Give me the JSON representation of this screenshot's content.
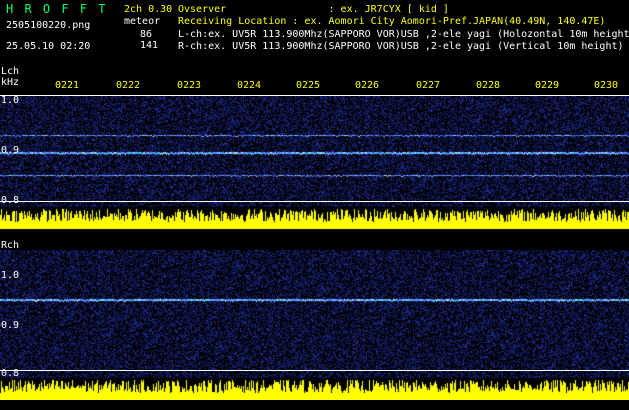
{
  "header": {
    "app_name": "H R O F F T",
    "mode": "2ch 0.30",
    "file_name": "2505100220.png",
    "meteor_label": "meteor",
    "datetime": "25.05.10 02:20",
    "l_count": "86",
    "r_count": "141",
    "observer_line": "Ovserver                 : ex. JR7CYX [ kid ]",
    "location_line": "Receiving Location : ex. Aomori City Aomori-Pref.JAPAN(40.49N, 140.47E)",
    "lch_info": "L-ch:ex. UV5R 113.900Mhz(SAPPORO VOR)USB ,2-ele yagi (Holozontal 10m height)",
    "rch_info": "R-ch:ex. UV5R 113.900Mhz(SAPPORO VOR)USB ,2-ele yagi (Vertical 10m height)"
  },
  "time_axis": [
    "0221",
    "0222",
    "0223",
    "0224",
    "0225",
    "0226",
    "0227",
    "0228",
    "0229",
    "0230"
  ],
  "lch": {
    "label": "Lch",
    "unit": "kHz",
    "freq_ticks": [
      "1.0",
      "0.9",
      "0.8"
    ]
  },
  "rch": {
    "label": "Rch",
    "freq_ticks": [
      "1.0",
      "0.9",
      "0.8"
    ]
  },
  "colors": {
    "background": "#000000",
    "noise": "#2030a0",
    "signal": "#40c0ff",
    "amplitude": "#ffff00",
    "amplitude_base": "#00c0ff",
    "header_text_white": "#ffffff",
    "header_text_yellow": "#ffff00",
    "app_name_green": "#00ff66"
  }
}
